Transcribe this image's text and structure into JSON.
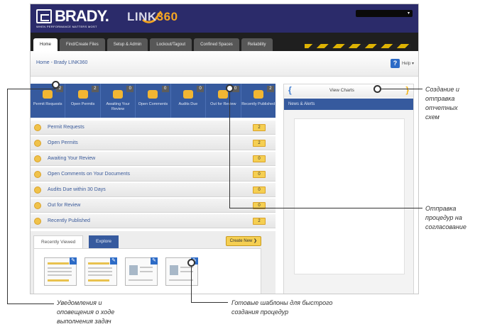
{
  "header": {
    "brand": "BRADY.",
    "brand_tagline": "WHEN PERFORMANCE MATTERS MOST",
    "product_prefix": "LINK",
    "product_suffix": "360",
    "user_caret": "▾"
  },
  "nav": {
    "tabs": [
      {
        "label": "Home",
        "active": true
      },
      {
        "label": "Find/Create Files",
        "active": false
      },
      {
        "label": "Setup & Admin",
        "active": false
      },
      {
        "label": "Lockout/Tagout",
        "active": false
      },
      {
        "label": "Confined Spaces",
        "active": false
      },
      {
        "label": "Reliability",
        "active": false
      }
    ]
  },
  "breadcrumb": "Home - Brady LINK360",
  "help": {
    "icon": "?",
    "label": "Help ▾"
  },
  "tiles": [
    {
      "label": "Permit Requests",
      "badge": "2",
      "icon": "people-icon"
    },
    {
      "label": "Open Permits",
      "badge": "2",
      "icon": "document-icon"
    },
    {
      "label": "Awaiting Your Review",
      "badge": "0",
      "icon": "star-icon"
    },
    {
      "label": "Open Comments",
      "badge": "0",
      "icon": "comment-icon"
    },
    {
      "label": "Audits Due",
      "badge": "0",
      "icon": "calendar-icon"
    },
    {
      "label": "Out for Review",
      "badge": "0",
      "icon": "gears-icon"
    },
    {
      "label": "Recently Published",
      "badge": "2",
      "icon": "publish-icon"
    }
  ],
  "rows": [
    {
      "label": "Permit Requests",
      "count": "2"
    },
    {
      "label": "Open Permits",
      "count": "2"
    },
    {
      "label": "Awaiting Your Review",
      "count": "0"
    },
    {
      "label": "Open Comments on Your Documents",
      "count": "0"
    },
    {
      "label": "Audits Due within 30 Days",
      "count": "0"
    },
    {
      "label": "Out for Review",
      "count": "0"
    },
    {
      "label": "Recently Published",
      "count": "2"
    }
  ],
  "viewed": {
    "tab_recent": "Recently Viewed",
    "tab_explore": "Explore",
    "create_new": "Create New ❯",
    "edit_icon": "✎"
  },
  "right_panel": {
    "left_bracket": "{",
    "right_bracket": "}",
    "view_charts": "View Charts",
    "news": "News & Alerts"
  },
  "callouts": {
    "reports": "Создание и\nотправка\nотчетных\nсхем",
    "review": "Отправка\nпроцедур на\nсогласование",
    "alerts": "Уведомления и\nоповещения о ходе\nвыполнения задач",
    "templates": "Готовые шаблоны для быстрого\nсоздания процедур"
  },
  "colors": {
    "header": "#2b2b6a",
    "tile_blue": "#365a9e",
    "accent_yellow": "#f5cf52",
    "link_blue": "#3a5a9a"
  }
}
